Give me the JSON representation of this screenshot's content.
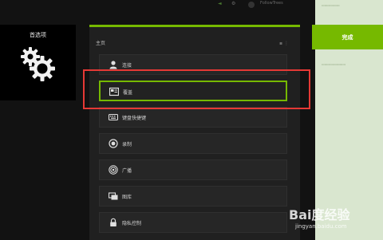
{
  "topbar": {
    "user_label": "FollowTrees"
  },
  "left_panel": {
    "title": "首选项",
    "icon": "gears-icon"
  },
  "modal": {
    "header": "主页",
    "accent_color": "#76b900",
    "items": [
      {
        "label": "连接",
        "icon": "user-icon"
      },
      {
        "label": "覆盖",
        "icon": "overlay-icon",
        "selected": true
      },
      {
        "label": "键盘快捷键",
        "icon": "keyboard-icon"
      },
      {
        "label": "录制",
        "icon": "record-icon"
      },
      {
        "label": "广播",
        "icon": "broadcast-icon"
      },
      {
        "label": "图库",
        "icon": "gallery-icon"
      },
      {
        "label": "隐私控制",
        "icon": "lock-icon"
      }
    ]
  },
  "done_button": {
    "label": "完成"
  },
  "watermark": {
    "text": "Bai度经验",
    "url": "jingyan.baidu.com"
  }
}
